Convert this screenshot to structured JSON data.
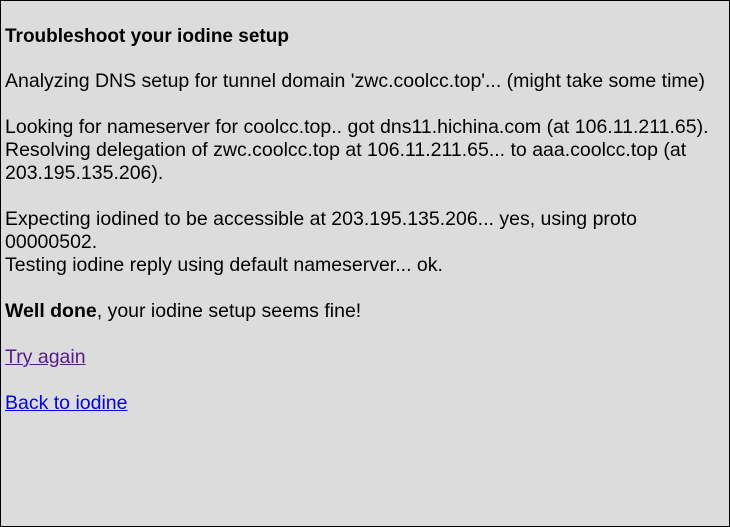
{
  "page": {
    "title": "Troubleshoot your iodine setup"
  },
  "log": {
    "analyzing": "Analyzing DNS setup for tunnel domain 'zwc.coolcc.top'... (might take some time)",
    "nameserver_line": "Looking for nameserver for coolcc.top.. got dns11.hichina.com (at 106.11.211.65).",
    "delegation_line": "Resolving delegation of zwc.coolcc.top at 106.11.211.65... to aaa.coolcc.top (at 203.195.135.206).",
    "accessible_line": "Expecting iodined to be accessible at 203.195.135.206... yes, using proto 00000502.",
    "reply_line": "Testing iodine reply using default nameserver... ok."
  },
  "result": {
    "strong": "Well done",
    "rest": ", your iodine setup seems fine!"
  },
  "links": {
    "try_again": "Try again",
    "back": "Back to iodine"
  },
  "colors": {
    "background": "#dcdcdc",
    "link": "#0000ee",
    "visited_link": "#551a8b"
  }
}
